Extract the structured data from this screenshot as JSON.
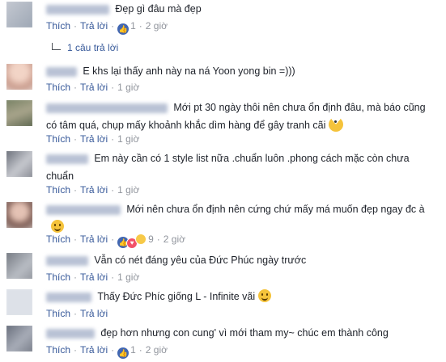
{
  "labels": {
    "like": "Thích",
    "reply": "Trả lời",
    "dot": "·"
  },
  "replies_link": "1 câu trả lời",
  "comments": [
    {
      "text": "Đẹp gì đâu mà đẹp",
      "reactions": "like",
      "count": "1",
      "time": "2 giờ"
    },
    {
      "text": "E khs lại thấy anh này na ná Yoon yong bin =)))",
      "reactions": "",
      "count": "",
      "time": "1 giờ"
    },
    {
      "text": "Mới pt 30 ngày thôi nên chưa ổn định đâu, mà báo cũng có tâm quá, chụp mấy khoảnh khắc dìm hàng để gây tranh cãi",
      "emoji": "pacman-icon",
      "reactions": "",
      "count": "",
      "time": "1 giờ"
    },
    {
      "text": "Em này cần có 1 style list nữa .chuẩn luôn .phong cách mặc còn chưa chuẩn",
      "reactions": "",
      "count": "",
      "time": "1 giờ"
    },
    {
      "text": "Mới nên chưa ổn định nên cứng chứ mấy má muốn đẹp ngay đc à",
      "emoji": "expressionless-face-icon",
      "reactions": "like,love,wow",
      "count": "9",
      "time": "2 giờ"
    },
    {
      "text": "Vẫn có nét đáng yêu của Đức Phúc ngày trước",
      "reactions": "",
      "count": "",
      "time": "1 giờ"
    },
    {
      "text": "Thấy Đức Phíc giống L - Infinite vãi",
      "emoji": "laughing-face-icon",
      "reactions": "",
      "count": "",
      "time": ""
    },
    {
      "text": "đẹp hơn nhưng con cung' vì mới tham my~ chúc em thành công",
      "reactions": "like",
      "count": "1",
      "time": "2 giờ"
    }
  ],
  "colors": {
    "link": "#365899",
    "meta": "#90949c",
    "like_blue": "#4267b2"
  }
}
